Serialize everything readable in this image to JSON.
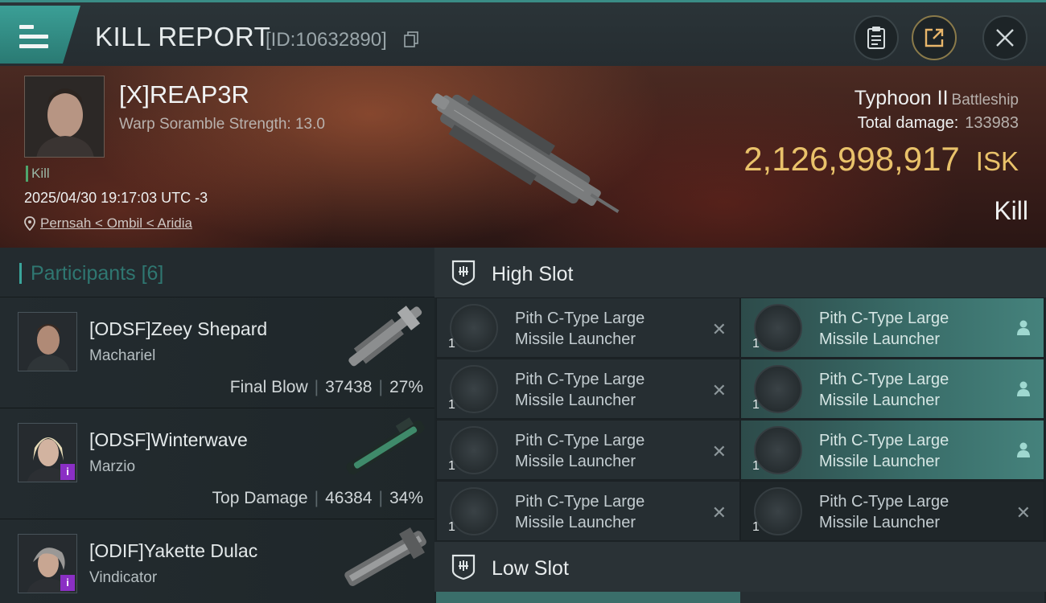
{
  "header": {
    "title": "KILL REPORT",
    "report_id": "[ID:10632890]"
  },
  "victim": {
    "name": "[X]REAP3R",
    "warp_scramble": "Warp Soramble Strength: 13.0",
    "tag": "Kill",
    "time": "2025/04/30 19:17:03 UTC -3",
    "location": "Pernsah < Ombil < Aridia",
    "ship_name": "Typhoon II",
    "ship_class": "Battleship",
    "total_damage_label": "Total damage:",
    "total_damage_value": "133983",
    "isk_amount": "2,126,998,917",
    "isk_unit": "ISK",
    "result": "Kill"
  },
  "participants": {
    "label": "Participants",
    "count": "[6]",
    "items": [
      {
        "name": "[ODSF]Zeey Shepard",
        "ship": "Machariel",
        "role": "Final Blow",
        "damage": "37438",
        "percent": "27%"
      },
      {
        "name": "[ODSF]Winterwave",
        "ship": "Marzio",
        "role": "Top Damage",
        "damage": "46384",
        "percent": "34%",
        "badge": "i"
      },
      {
        "name": "[ODIF]Yakette Dulac",
        "ship": "Vindicator",
        "badge": "i"
      }
    ]
  },
  "slots": {
    "high_label": "High Slot",
    "low_label": "Low Slot",
    "high_modules": [
      {
        "qty": "1",
        "line1": "Pith C-Type Large",
        "line2": "Missile Launcher",
        "state": "destroyed",
        "icon": "close-icon"
      },
      {
        "qty": "1",
        "line1": "Pith C-Type Large",
        "line2": "Missile Launcher",
        "state": "dropped",
        "icon": "person-icon"
      },
      {
        "qty": "1",
        "line1": "Pith C-Type Large",
        "line2": "Missile Launcher",
        "state": "destroyed",
        "icon": "close-icon"
      },
      {
        "qty": "1",
        "line1": "Pith C-Type Large",
        "line2": "Missile Launcher",
        "state": "dropped",
        "icon": "person-icon"
      },
      {
        "qty": "1",
        "line1": "Pith C-Type Large",
        "line2": "Missile Launcher",
        "state": "destroyed",
        "icon": "close-icon"
      },
      {
        "qty": "1",
        "line1": "Pith C-Type Large",
        "line2": "Missile Launcher",
        "state": "dropped",
        "icon": "person-icon"
      },
      {
        "qty": "1",
        "line1": "Pith C-Type Large",
        "line2": "Missile Launcher",
        "state": "destroyed",
        "icon": "close-icon"
      },
      {
        "qty": "1",
        "line1": "Pith C-Type Large",
        "line2": "Missile Launcher",
        "state": "destroyed",
        "icon": "close-icon"
      }
    ]
  },
  "colors": {
    "accent_teal": "#3aa59b",
    "isk_gold": "#e9c26a",
    "badge_purple": "#8a2fc4"
  }
}
